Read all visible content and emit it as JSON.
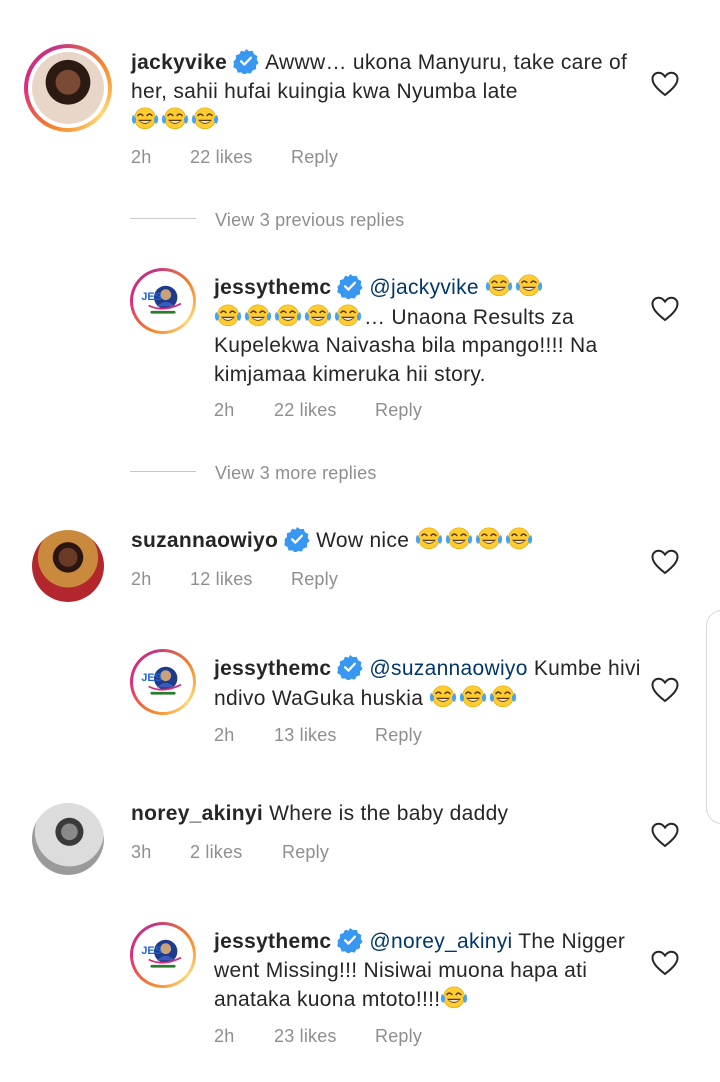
{
  "comments": [
    {
      "username": "jackyvike",
      "text": "Awww… ukona Manyuru, take care of her, sahii hufai kuingia kwa Nyumba late",
      "emoji_count": 3,
      "time": "2h",
      "likes": "22 likes",
      "reply_label": "Reply",
      "view_replies": "View 3 previous replies"
    },
    {
      "username": "jessythemc",
      "mention": "@jackyvike",
      "text": "… Unaona Results za Kupelekwa Naivasha bila mpango!!!! Na kimjamaa kimeruka hii story.",
      "time": "2h",
      "likes": "22 likes",
      "reply_label": "Reply",
      "view_replies": "View 3 more replies"
    },
    {
      "username": "suzannaowiyo",
      "text": "Wow nice",
      "time": "2h",
      "likes": "12 likes",
      "reply_label": "Reply"
    },
    {
      "username": "jessythemc",
      "mention": "@suzannaowiyo",
      "text": "Kumbe hivi ndivo WaGuka huskia",
      "time": "2h",
      "likes": "13 likes",
      "reply_label": "Reply"
    },
    {
      "username": "norey_akinyi",
      "text": "Where is the baby daddy",
      "time": "3h",
      "likes": "2 likes",
      "reply_label": "Reply"
    },
    {
      "username": "jessythemc",
      "mention": "@norey_akinyi",
      "text": "The Nigger went Missing!!! Nisiwai muona hapa ati anataka kuona mtoto!!!!",
      "time": "2h",
      "likes": "23 likes",
      "reply_label": "Reply"
    }
  ],
  "colors": {
    "verified": "#3897f0",
    "mention": "#00376b",
    "meta": "#8e8e8e",
    "text": "#262626"
  },
  "icons": {
    "like": "heart-outline-icon",
    "verified": "verified-badge-icon",
    "emoji": "face-with-tears-of-joy-emoji"
  }
}
